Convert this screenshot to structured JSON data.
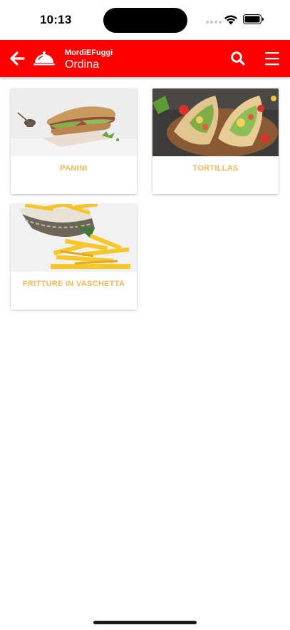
{
  "status": {
    "time": "10:13"
  },
  "header": {
    "brand": "MordiEFuggi",
    "title": "Ordina"
  },
  "colors": {
    "app_bar": "#fe0000",
    "category_label": "#f2b851"
  },
  "icons": {
    "back": "arrow-left-icon",
    "logo": "serving-cloche-icon",
    "search": "search-icon",
    "menu": "hamburger-menu-icon"
  },
  "categories": [
    {
      "label": "PANINI",
      "image": "panino sandwich photo"
    },
    {
      "label": "TORTILLAS",
      "image": "tortilla wraps photo"
    },
    {
      "label": "FRITTURE IN VASCHETTA",
      "image": "french fries tray photo"
    }
  ]
}
